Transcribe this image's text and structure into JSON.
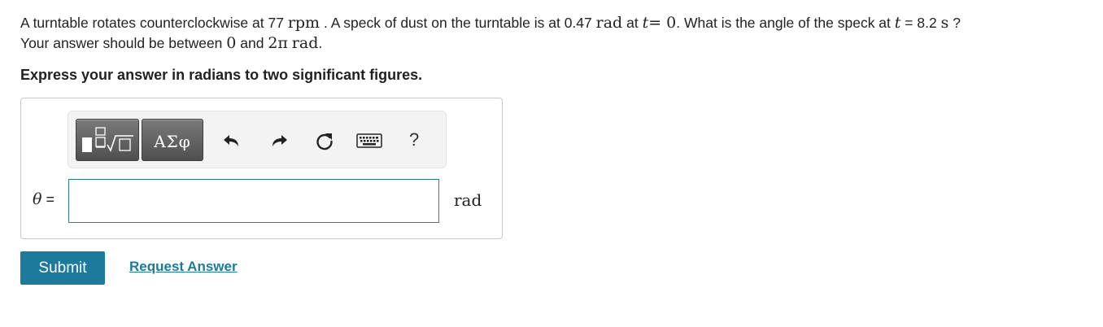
{
  "question": {
    "p1": "A turntable rotates counterclockwise at 77",
    "rpm": "rpm",
    "p2": ". A speck of dust on the turntable is at 0.47",
    "rad1": "rad",
    "p3": "at",
    "t1": "t",
    "eq0": "= 0",
    "p4": ". What is the angle of the speck at",
    "t2": "t",
    "p5": "= 8.2",
    "s": "s",
    "p6": "?",
    "p7": "Your answer should be between",
    "zero": "0",
    "p8": "and",
    "twopi": "2π",
    "rad2": "rad",
    "p9": "."
  },
  "instruction": "Express your answer in radians to two significant figures.",
  "toolbar": {
    "symbols_label": "ΑΣφ",
    "help_label": "?",
    "icons": [
      "templates-icon",
      "undo-icon",
      "redo-icon",
      "reset-icon",
      "keyboard-icon",
      "help-icon"
    ]
  },
  "answer": {
    "variable": "θ",
    "equals": "=",
    "value": "",
    "unit": "rad"
  },
  "actions": {
    "submit_label": "Submit",
    "request_label": "Request Answer"
  },
  "colors": {
    "accent": "#1c7a9c",
    "input_border": "#2a7f98"
  }
}
